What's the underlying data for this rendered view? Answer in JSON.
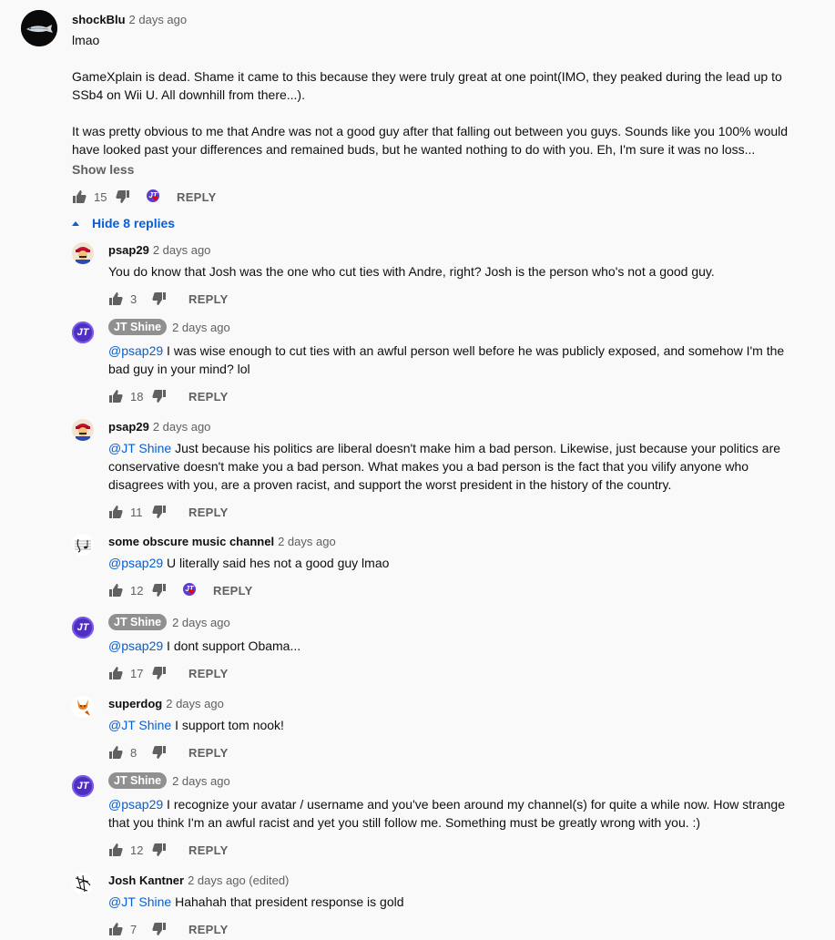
{
  "top_comment": {
    "author": "shockBlu",
    "time": "2 days ago",
    "paragraphs": [
      "lmao",
      "GameXplain is dead. Shame it came to this because they were truly great at one point(IMO, they peaked during the lead up to SSb4 on Wii U. All downhill from there...).",
      "It was pretty obvious to me that Andre was not a good guy after that falling out between you guys. Sounds like you 100% would have looked past your differences and remained buds, but he wanted nothing to do with you. Eh, I'm sure it was no loss..."
    ],
    "show_less": "Show less",
    "likes": "15",
    "reply_label": "REPLY",
    "creator_heart": true
  },
  "replies_toggle": "Hide 8 replies",
  "replies": [
    {
      "author": "psap29",
      "owner": false,
      "time": "2 days ago",
      "mention": "",
      "text": "You do know that Josh was the one who cut ties with Andre, right?  Josh is the person who's not a good guy.",
      "likes": "3",
      "heart": false,
      "reply_label": "REPLY",
      "avatar": "mario-avatar"
    },
    {
      "author": "JT Shine",
      "owner": true,
      "time": "2 days ago",
      "mention": "@psap29",
      "text": "I was wise enough to cut ties with an awful person well before he was publicly exposed, and somehow I'm the bad guy in your mind? lol",
      "likes": "18",
      "heart": false,
      "reply_label": "REPLY",
      "avatar": "jt-avatar"
    },
    {
      "author": "psap29",
      "owner": false,
      "time": "2 days ago",
      "mention": "@JT Shine",
      "text": "Just because his politics are liberal doesn't make him a bad person.  Likewise, just because your politics are conservative doesn't make you a bad person.  What makes you a bad person is  the fact that you vilify anyone who disagrees with you, are a proven racist, and support the worst president in the history of the country.",
      "likes": "11",
      "heart": false,
      "reply_label": "REPLY",
      "avatar": "mario-avatar"
    },
    {
      "author": "some obscure music channel",
      "owner": false,
      "time": "2 days ago",
      "mention": "@psap29",
      "text": "U literally said hes not a good guy lmao",
      "likes": "12",
      "heart": true,
      "reply_label": "REPLY",
      "avatar": "music-avatar"
    },
    {
      "author": "JT Shine",
      "owner": true,
      "time": "2 days ago",
      "mention": "@psap29",
      "text": "I dont support Obama...",
      "likes": "17",
      "heart": false,
      "reply_label": "REPLY",
      "avatar": "jt-avatar"
    },
    {
      "author": "superdog",
      "owner": false,
      "time": "2 days ago",
      "mention": "@JT Shine",
      "text": "I support tom nook!",
      "likes": "8",
      "heart": false,
      "reply_label": "REPLY",
      "avatar": "fox-avatar"
    },
    {
      "author": "JT Shine",
      "owner": true,
      "time": "2 days ago",
      "mention": "@psap29",
      "text": "I recognize your avatar / username and you've been around my channel(s) for quite a while now. How strange that you think I'm an awful racist and yet you still follow me. Something must be greatly wrong with you. :)",
      "likes": "12",
      "heart": false,
      "reply_label": "REPLY",
      "avatar": "jt-avatar"
    },
    {
      "author": "Josh Kantner",
      "owner": false,
      "time": "2 days ago (edited)",
      "mention": "@JT Shine",
      "text": "Hahahah that president response is gold",
      "likes": "7",
      "heart": false,
      "reply_label": "REPLY",
      "avatar": "sketch-avatar"
    }
  ],
  "jt_initials": "JT"
}
